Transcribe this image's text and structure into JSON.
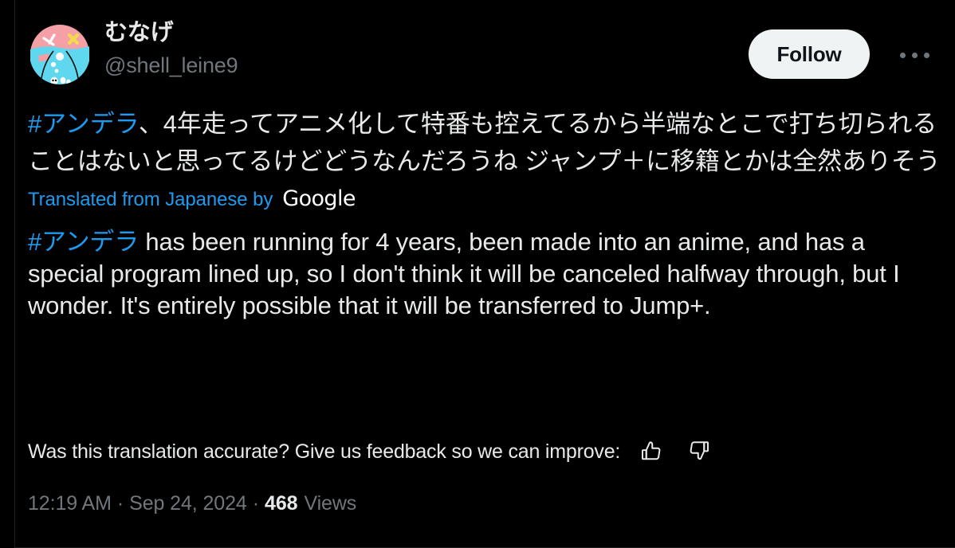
{
  "colors": {
    "background": "#000000",
    "text_primary": "#e7e9ea",
    "text_muted": "#71767b",
    "accent_blue": "#1d9bf0",
    "follow_bg": "#eff3f4",
    "follow_text": "#0f1419",
    "border": "#1b1f23",
    "avatar_pink": "#f4a0a6",
    "avatar_cyan": "#5fd8ef",
    "avatar_yellow": "#f2d94e"
  },
  "header": {
    "display_name": "むなげ",
    "handle": "@shell_leine9",
    "follow_label": "Follow",
    "more_icon": "more-horizontal-icon",
    "avatar_icon": "avatar"
  },
  "post": {
    "source": {
      "hashtag": "#アンデラ",
      "rest": "、4年走ってアニメ化して特番も控えてるから半端なとこで打ち切られることはないと思ってるけどどうなんだろうね\nジャンプ＋に移籍とかは全然ありそう"
    },
    "translation_attribution": {
      "label": "Translated from Japanese by",
      "provider": "Google"
    },
    "translated": {
      "hashtag": "#アンデラ",
      "rest": " has been running for 4 years, been made into an anime, and has a special program lined up, so I don't think it will be canceled halfway through, but I wonder. It's entirely possible that it will be transferred to Jump+."
    },
    "feedback": {
      "prompt": "Was this translation accurate? Give us feedback so we can improve:",
      "thumbs_up_icon": "thumbs-up-icon",
      "thumbs_down_icon": "thumbs-down-icon"
    },
    "meta": {
      "time": "12:19 AM",
      "separator_1": "·",
      "date": "Sep 24, 2024",
      "separator_2": "·",
      "views_count": "468",
      "views_label": "Views"
    }
  }
}
